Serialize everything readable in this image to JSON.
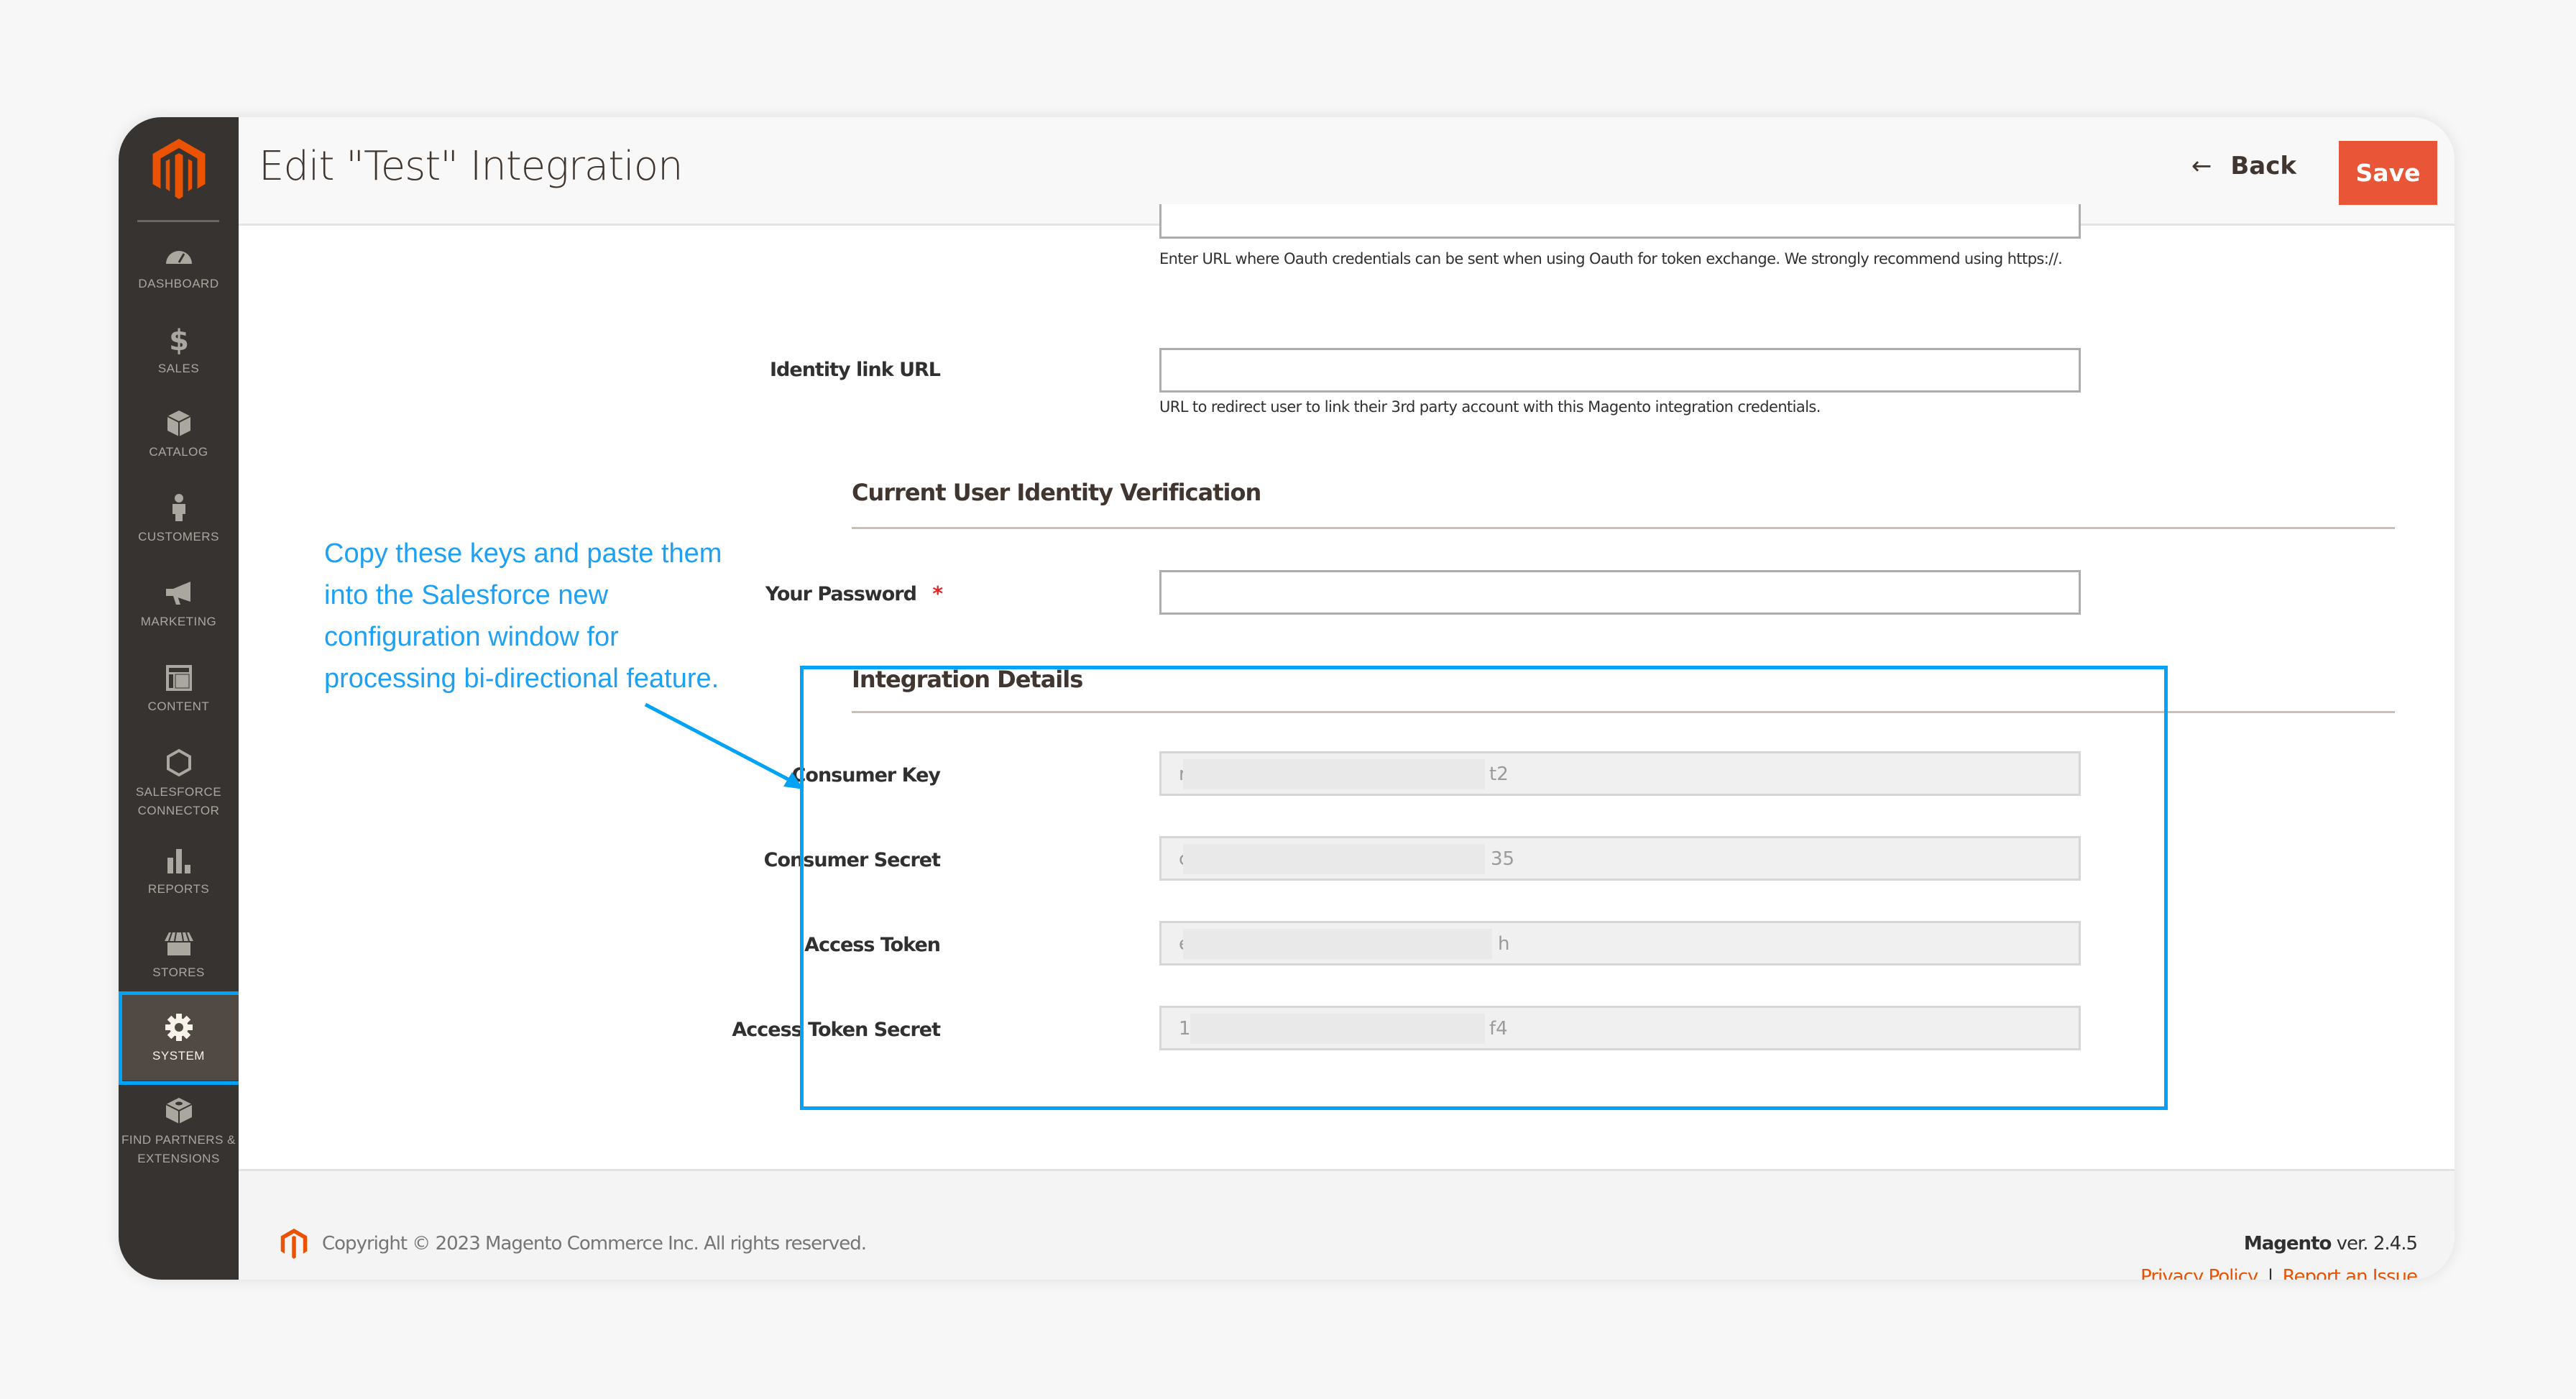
{
  "header": {
    "title": "Edit \"Test\" Integration",
    "back_label": "Back",
    "save_label": "Save"
  },
  "sidebar": {
    "items": [
      {
        "id": "dashboard",
        "label": "Dashboard",
        "icon": "dashboard-gauge-icon"
      },
      {
        "id": "sales",
        "label": "Sales",
        "icon": "dollar-icon"
      },
      {
        "id": "catalog",
        "label": "Catalog",
        "icon": "box-icon"
      },
      {
        "id": "customers",
        "label": "Customers",
        "icon": "person-icon"
      },
      {
        "id": "marketing",
        "label": "Marketing",
        "icon": "megaphone-icon"
      },
      {
        "id": "content",
        "label": "Content",
        "icon": "layout-icon"
      },
      {
        "id": "salesforce",
        "label": "Salesforce Connector",
        "icon": "hexagon-icon"
      },
      {
        "id": "reports",
        "label": "Reports",
        "icon": "bar-chart-icon"
      },
      {
        "id": "stores",
        "label": "Stores",
        "icon": "storefront-icon"
      },
      {
        "id": "system",
        "label": "System",
        "icon": "gear-icon",
        "active": true
      },
      {
        "id": "partners",
        "label": "Find Partners & Extensions",
        "icon": "blocks-icon"
      }
    ]
  },
  "form": {
    "callback_note": "Enter URL where Oauth credentials can be sent when using Oauth for token exchange. We strongly recommend using https://.",
    "identity_link_label": "Identity link URL",
    "identity_link_value": "",
    "identity_link_note": "URL to redirect user to link their 3rd party account with this Magento integration credentials.",
    "verification_title": "Current User Identity Verification",
    "password_label": "Your Password",
    "password_required": "*",
    "password_value": "",
    "details_title": "Integration Details",
    "details": [
      {
        "label": "Consumer Key",
        "value_start": "r",
        "value_end": "t2"
      },
      {
        "label": "Consumer Secret",
        "value_start": "c",
        "value_end": "35"
      },
      {
        "label": "Access Token",
        "value_start": "e",
        "value_end": "h"
      },
      {
        "label": "Access Token Secret",
        "value_start": "12",
        "value_end": "f4"
      }
    ]
  },
  "annotation": {
    "text": "Copy these keys and paste them into the Salesforce new configuration window for processing bi-directional feature.",
    "color": "#00a3f5"
  },
  "footer": {
    "copyright": "Copyright © 2023 Magento Commerce Inc. All rights reserved.",
    "brand": "Magento",
    "version": " ver. 2.4.5",
    "privacy_label": "Privacy Policy",
    "separator": "|",
    "report_label": "Report an Issue"
  },
  "colors": {
    "accent": "#eb5202",
    "save_button": "#e85537",
    "sidebar_bg": "#373330",
    "annotation": "#00a3f5"
  }
}
